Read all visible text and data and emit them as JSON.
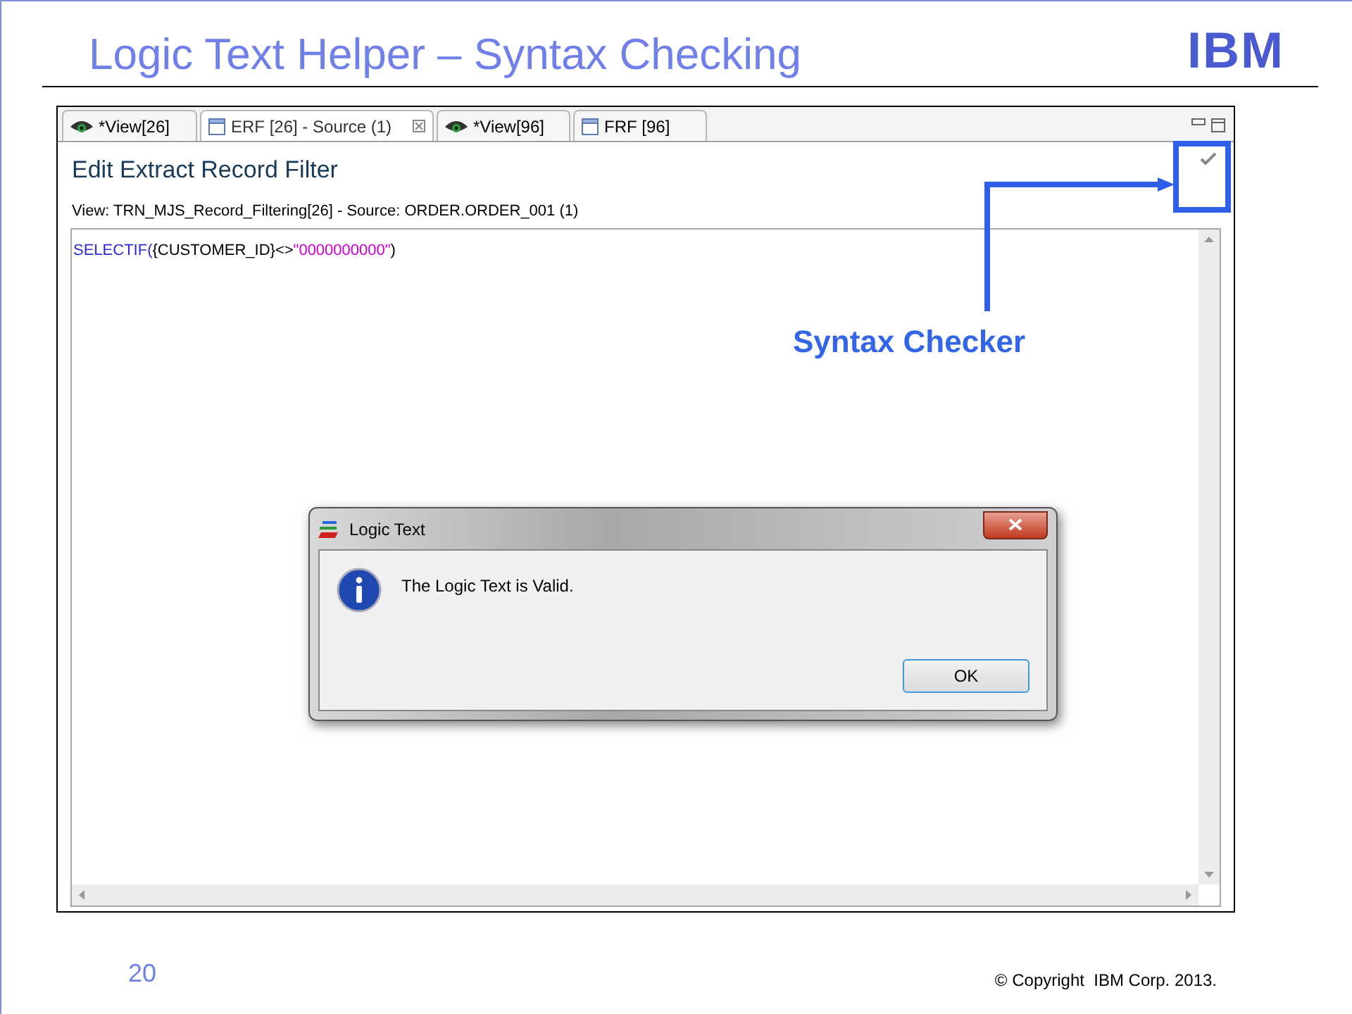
{
  "slide": {
    "title": "Logic Text Helper – Syntax Checking",
    "logo": "IBM",
    "page_number": "20",
    "copyright": "© Copyright  IBM Corp. 2013."
  },
  "tabs": [
    {
      "label": "*View[26]",
      "kind": "view",
      "selected": false
    },
    {
      "label": "ERF [26] - Source (1)",
      "kind": "editor",
      "selected": true
    },
    {
      "label": "*View[96]",
      "kind": "view",
      "selected": false
    },
    {
      "label": "FRF [96]",
      "kind": "editor",
      "selected": false
    }
  ],
  "editor": {
    "heading": "Edit Extract Record Filter",
    "subtitle": "View: TRN_MJS_Record_Filtering[26] - Source: ORDER.ORDER_001 (1)",
    "code": [
      {
        "kind": "keyword",
        "text": "SELECTIF("
      },
      {
        "kind": "plain",
        "text": "{CUSTOMER_ID}<>"
      },
      {
        "kind": "string",
        "text": "\"0000000000\""
      },
      {
        "kind": "plain",
        "text": ")"
      }
    ]
  },
  "callout": {
    "label": "Syntax Checker"
  },
  "dialog": {
    "title": "Logic Text",
    "message": "The Logic Text is Valid.",
    "button": "OK"
  }
}
